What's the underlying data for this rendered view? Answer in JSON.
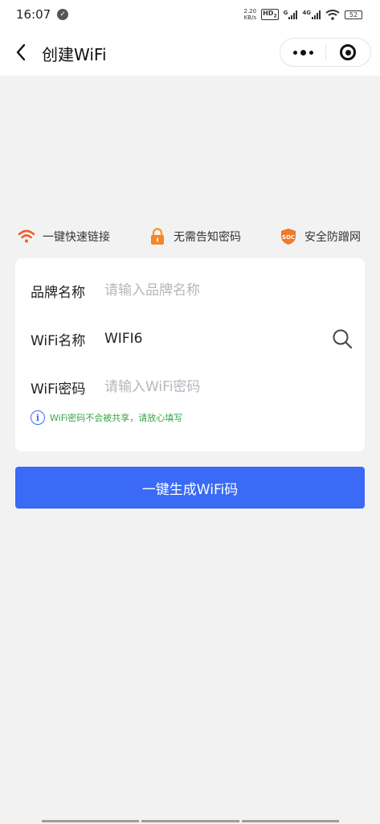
{
  "status_bar": {
    "time": "16:07",
    "net_speed_value": "2.20",
    "net_speed_unit": "KB/s",
    "hd_label": "HD",
    "hd_sub": "2",
    "signal1_label": "G",
    "signal2_label": "4G",
    "battery": "52"
  },
  "nav": {
    "title": "创建WiFi"
  },
  "features": [
    {
      "label": "一键快速链接",
      "icon": "wifi-icon",
      "color": "#e8632b"
    },
    {
      "label": "无需告知密码",
      "icon": "lock-icon",
      "color": "#f59a2b"
    },
    {
      "label": "安全防蹭网",
      "icon": "soc-shield-icon",
      "color": "#ee7a2a",
      "icon_text": "SOC"
    }
  ],
  "form": {
    "brand": {
      "label": "品牌名称",
      "value": "",
      "placeholder": "请输入品牌名称"
    },
    "wifi_name": {
      "label": "WiFi名称",
      "value": "WIFI6",
      "placeholder": ""
    },
    "wifi_password": {
      "label": "WiFi密码",
      "value": "",
      "placeholder": "请输入WiFi密码"
    },
    "hint": "WiFi密码不会被共享，请放心填写"
  },
  "generate_button": {
    "label": "一键生成WiFi码"
  },
  "colors": {
    "primary": "#3a6af6",
    "hint_green": "#3aa34a",
    "background": "#f2f2f3"
  }
}
